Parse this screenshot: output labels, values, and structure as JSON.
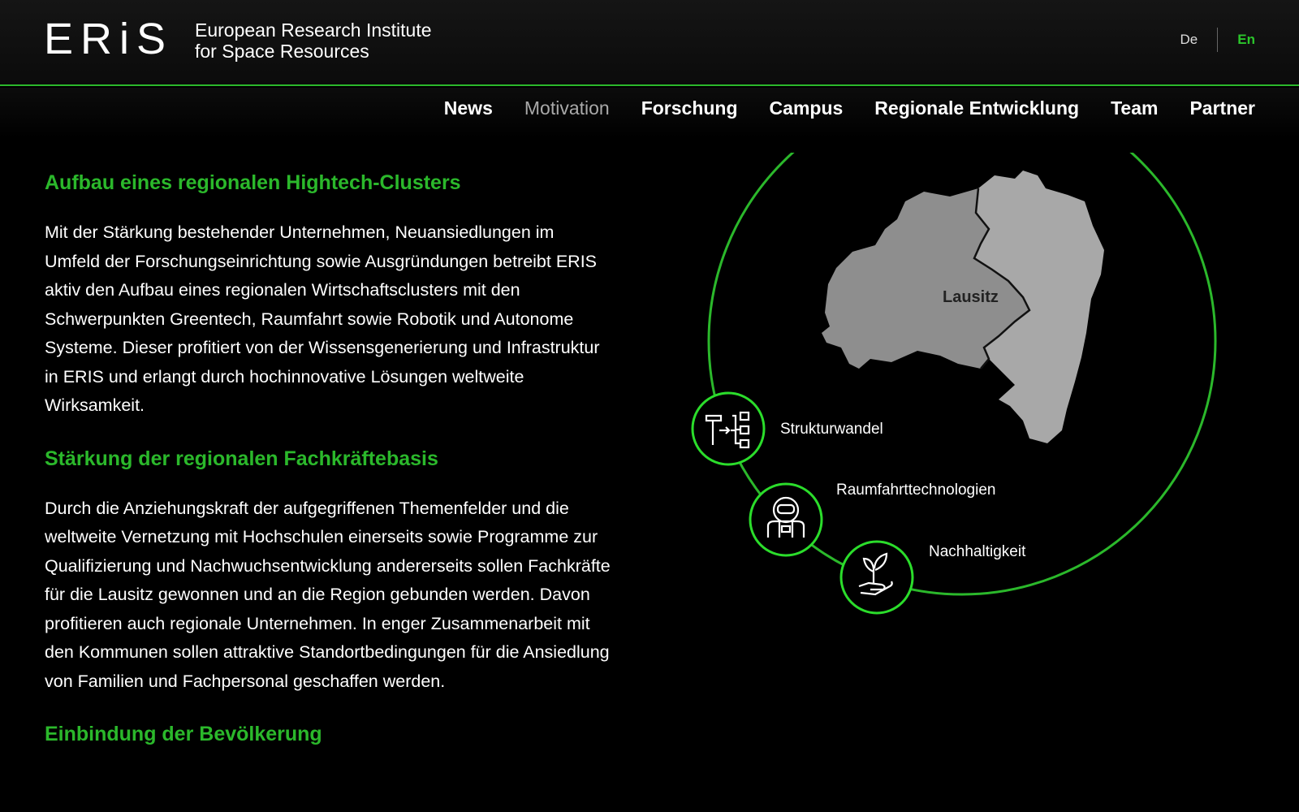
{
  "brand": {
    "logo_mark": "ERiS",
    "name_line1": "European Research Institute",
    "name_line2": "for Space Resources"
  },
  "language": {
    "de": "De",
    "en": "En",
    "active": "En"
  },
  "nav": {
    "items": [
      "News",
      "Motivation",
      "Forschung",
      "Campus",
      "Regionale Entwicklung",
      "Team",
      "Partner"
    ],
    "current": "Motivation"
  },
  "sections": [
    {
      "heading": "Aufbau eines regionalen Hightech-Clusters",
      "body": "Mit der Stärkung bestehender Unternehmen, Neuansiedlungen im Umfeld der Forschungseinrichtung sowie Ausgründungen betreibt ERIS aktiv den Aufbau eines regionalen Wirtschaftsclusters mit den Schwerpunkten Greentech, Raumfahrt sowie Robotik und Autonome Systeme. Dieser profitiert von der Wissensgenerierung und Infrastruktur in ERIS und erlangt durch hochinnovative Lösungen weltweite Wirksamkeit."
    },
    {
      "heading": "Stärkung der regionalen Fachkräftebasis",
      "body": "Durch die Anziehungskraft der aufgegriffenen Themenfelder und die weltweite Vernetzung mit Hochschulen einerseits sowie Programme zur Qualifizierung und Nachwuchsentwicklung andererseits sollen Fachkräfte für die Lausitz gewonnen und an die Region gebunden werden. Davon profitieren auch regionale Unternehmen. In enger Zusammenarbeit mit den Kommunen sollen attraktive Standortbedingungen für die Ansiedlung von Familien und Fachpersonal geschaffen werden."
    },
    {
      "heading": "Einbindung der Bevölkerung"
    }
  ],
  "graphic": {
    "region_label": "Lausitz",
    "topics": [
      {
        "label": "Strukturwandel",
        "icon": "hammer-hierarchy-icon"
      },
      {
        "label": "Raumfahrttechnologien",
        "icon": "astronaut-icon"
      },
      {
        "label": "Nachhaltigkeit",
        "icon": "plant-in-hand-icon"
      }
    ]
  },
  "colors": {
    "accent": "#2bb82b",
    "accent_bright": "#33e033",
    "background": "#000000",
    "map_light": "#a8a8a8",
    "map_dark": "#8e8e8e"
  }
}
